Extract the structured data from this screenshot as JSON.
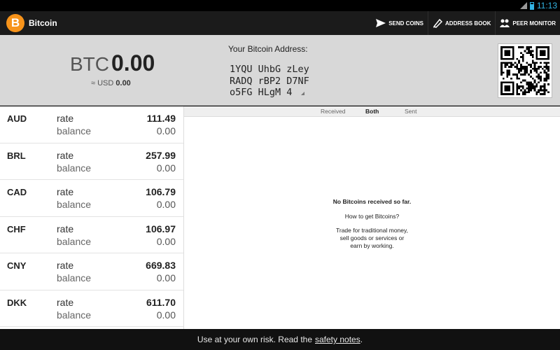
{
  "status": {
    "time": "11:13"
  },
  "app": {
    "logo_glyph": "B",
    "title": "Bitcoin"
  },
  "actions": [
    {
      "label": "SEND COINS",
      "icon": "send-icon"
    },
    {
      "label": "ADDRESS BOOK",
      "icon": "address-book-icon"
    },
    {
      "label": "PEER MONITOR",
      "icon": "peers-icon"
    }
  ],
  "balance": {
    "unit": "BTC",
    "value": "0.00",
    "local_prefix": "≈ USD",
    "local_value": "0.00"
  },
  "address": {
    "label": "Your Bitcoin Address:",
    "lines": [
      "1YQU UhbG zLey",
      "RADQ rBP2 D7NF",
      "o5FG HLgM 4"
    ]
  },
  "rates": [
    {
      "code": "AUD",
      "rate_label": "rate",
      "balance_label": "balance",
      "rate": "111.49",
      "balance": "0.00"
    },
    {
      "code": "BRL",
      "rate_label": "rate",
      "balance_label": "balance",
      "rate": "257.99",
      "balance": "0.00"
    },
    {
      "code": "CAD",
      "rate_label": "rate",
      "balance_label": "balance",
      "rate": "106.79",
      "balance": "0.00"
    },
    {
      "code": "CHF",
      "rate_label": "rate",
      "balance_label": "balance",
      "rate": "106.97",
      "balance": "0.00"
    },
    {
      "code": "CNY",
      "rate_label": "rate",
      "balance_label": "balance",
      "rate": "669.83",
      "balance": "0.00"
    },
    {
      "code": "DKK",
      "rate_label": "rate",
      "balance_label": "balance",
      "rate": "611.70",
      "balance": "0.00"
    }
  ],
  "tabs": [
    {
      "label": "Received",
      "active": false
    },
    {
      "label": "Both",
      "active": true
    },
    {
      "label": "Sent",
      "active": false
    }
  ],
  "empty_state": {
    "title": "No Bitcoins received so far.",
    "question": "How to get Bitcoins?",
    "lines": [
      "Trade for traditional money,",
      "sell goods or services or",
      "earn by working."
    ]
  },
  "footer": {
    "text": "Use at your own risk. Read the",
    "link": "safety notes",
    "suffix": "."
  },
  "colors": {
    "brand": "#f7931a",
    "status_accent": "#33b5e5",
    "actionbar": "#1b1b1b",
    "header_bg": "#d8d8d8"
  }
}
